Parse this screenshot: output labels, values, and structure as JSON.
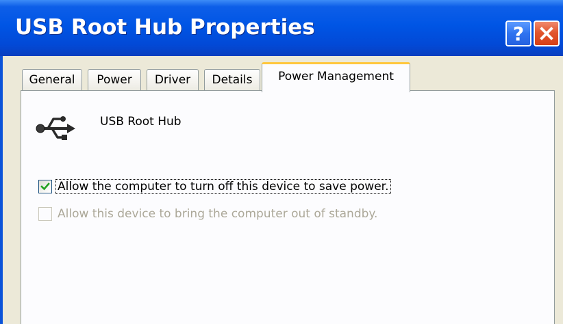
{
  "window": {
    "title": "USB Root Hub Properties",
    "help_symbol": "?",
    "accent_color": "#0055e5",
    "close_color": "#e2562f"
  },
  "tabs": [
    {
      "label": "General",
      "active": false
    },
    {
      "label": "Power",
      "active": false
    },
    {
      "label": "Driver",
      "active": false
    },
    {
      "label": "Details",
      "active": false
    },
    {
      "label": "Power Management",
      "active": true
    }
  ],
  "device": {
    "icon": "usb-icon",
    "name": "USB Root Hub"
  },
  "options": [
    {
      "label": "Allow the computer to turn off this device to save power.",
      "checked": true,
      "enabled": true,
      "focused": true
    },
    {
      "label": "Allow this device to bring the computer out of standby.",
      "checked": false,
      "enabled": false,
      "focused": false
    }
  ]
}
